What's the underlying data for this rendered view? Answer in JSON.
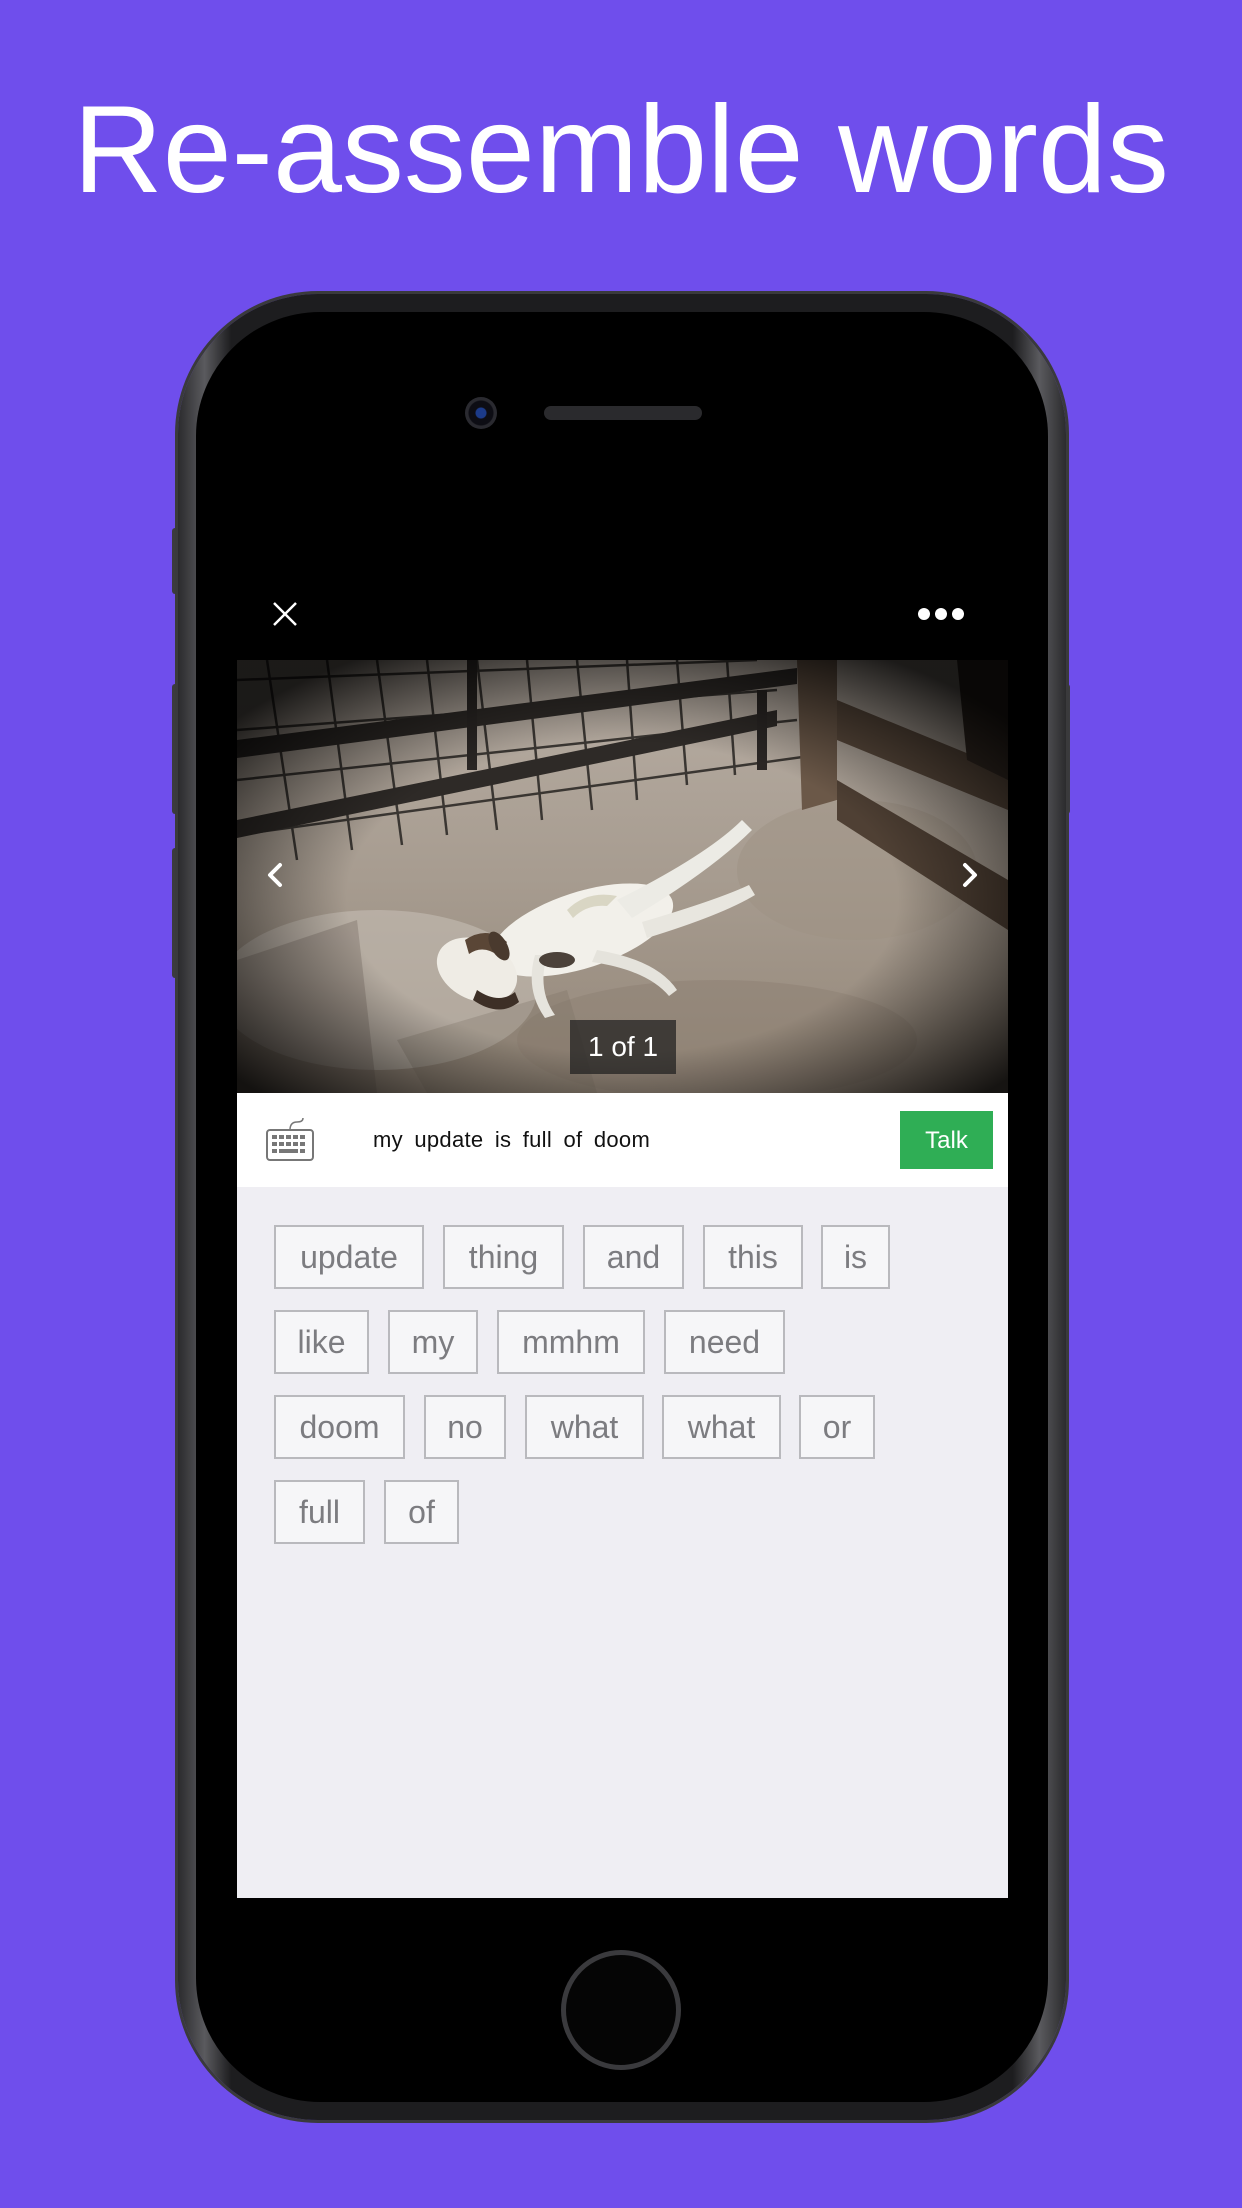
{
  "promo": {
    "headline": "Re-assemble words",
    "background_color": "#6f4eec"
  },
  "viewer": {
    "close_icon": "close-icon",
    "more_icon": "more-dots-icon",
    "prev_icon": "chevron-left-icon",
    "next_icon": "chevron-right-icon",
    "photo_counter": "1 of 1"
  },
  "composer": {
    "keyboard_icon": "keyboard-icon",
    "sentence": "my update is full of doom",
    "talk_label": "Talk",
    "talk_color": "#2fae55"
  },
  "word_bank": {
    "rows": [
      [
        "update",
        "thing",
        "and",
        "this",
        "is"
      ],
      [
        "like",
        "my",
        "mmhm",
        "need"
      ],
      [
        "doom",
        "no",
        "what",
        "what",
        "or"
      ],
      [
        "full",
        "of"
      ]
    ]
  }
}
